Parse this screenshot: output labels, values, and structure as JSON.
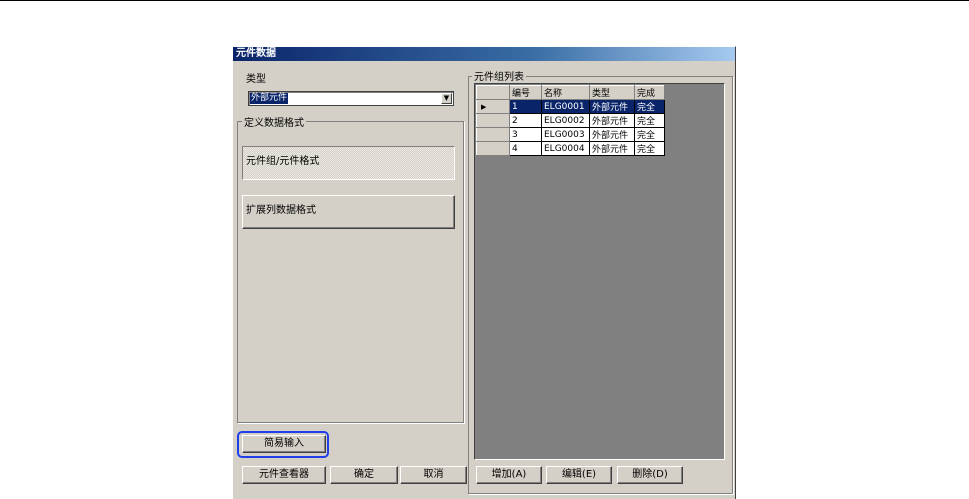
{
  "window": {
    "title": "元件数据"
  },
  "left": {
    "type_label": "类型",
    "type_value": "外部元件",
    "format_group_label": "定义数据格式",
    "btn_component_format": "元件组/元件格式",
    "btn_extended_format": "扩展列数据格式",
    "btn_easy_input": "简易输入",
    "btn_viewer": "元件查看器",
    "btn_ok": "确定",
    "btn_cancel": "取消"
  },
  "right": {
    "group_label": "元件组列表",
    "columns": [
      "编号",
      "名称",
      "类型",
      "完成"
    ],
    "rows": [
      {
        "no": "1",
        "name": "ELG0001",
        "type": "外部元件",
        "done": "完全"
      },
      {
        "no": "2",
        "name": "ELG0002",
        "type": "外部元件",
        "done": "完全"
      },
      {
        "no": "3",
        "name": "ELG0003",
        "type": "外部元件",
        "done": "完全"
      },
      {
        "no": "4",
        "name": "ELG0004",
        "type": "外部元件",
        "done": "完全"
      }
    ],
    "btn_add": "增加(A)",
    "btn_edit": "编辑(E)",
    "btn_delete": "删除(D)"
  }
}
